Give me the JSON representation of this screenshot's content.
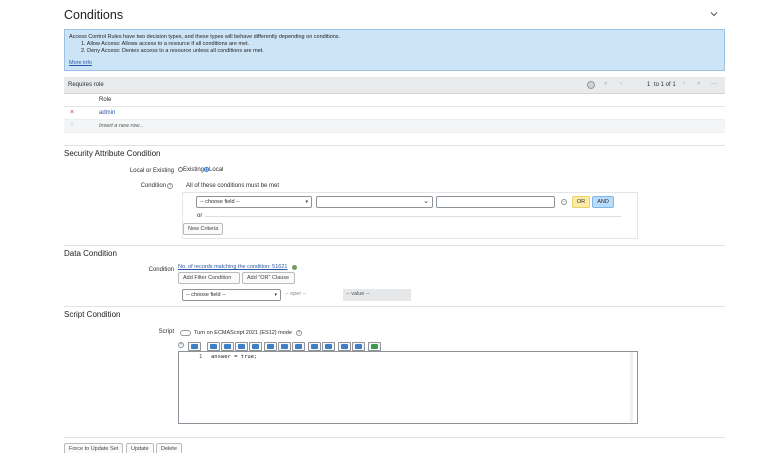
{
  "header": {
    "title": "Conditions"
  },
  "info": {
    "line1": "Access Control Rules have two decision types, and these types will behave differently depending on conditions.",
    "line2": "1. Allow Access: Allows access to a resource if all conditions are met.",
    "line3": "2. Deny Access: Denies access to a resource unless all conditions are met.",
    "more_info": "More info"
  },
  "requires_role": {
    "title": "Requires role",
    "pagination": {
      "first": "1",
      "to": "to 1 of 1"
    },
    "column_header": "Role",
    "rows": [
      {
        "role": "admin"
      }
    ],
    "insert_row": "Insert a new row..."
  },
  "security_attribute": {
    "title": "Security Attribute Condition",
    "local_or_existing_label": "Local or Existing",
    "option_existing": "Existing",
    "option_local": "Local",
    "condition_label": "Condition",
    "all_conditions": "All of these conditions must be met",
    "choose_field": "-- choose field --",
    "or_label": "or",
    "or_button": "OR",
    "and_button": "AND",
    "new_criteria": "New Criteria"
  },
  "data_condition": {
    "title": "Data Condition",
    "condition_label": "Condition",
    "records_link": "No. of records matching the condition: 51621",
    "add_filter": "Add Filter Condition",
    "add_or": "Add \"OR\" Clause",
    "choose_field": "-- choose field --",
    "oper": "-- oper --",
    "value": "-- value --"
  },
  "script_condition": {
    "title": "Script Condition",
    "script_label": "Script",
    "toggle_label": "Turn on ECMAScript 2021 (ES12) mode",
    "line_number": "1",
    "code": "answer = true;"
  },
  "footer": {
    "force_update": "Force to Update Set",
    "update": "Update",
    "delete": "Delete"
  },
  "colors": {
    "accent": "#2a57a4",
    "info_bg": "#cde4f7",
    "or": "#fceaa5",
    "and": "#b9dcfa"
  }
}
